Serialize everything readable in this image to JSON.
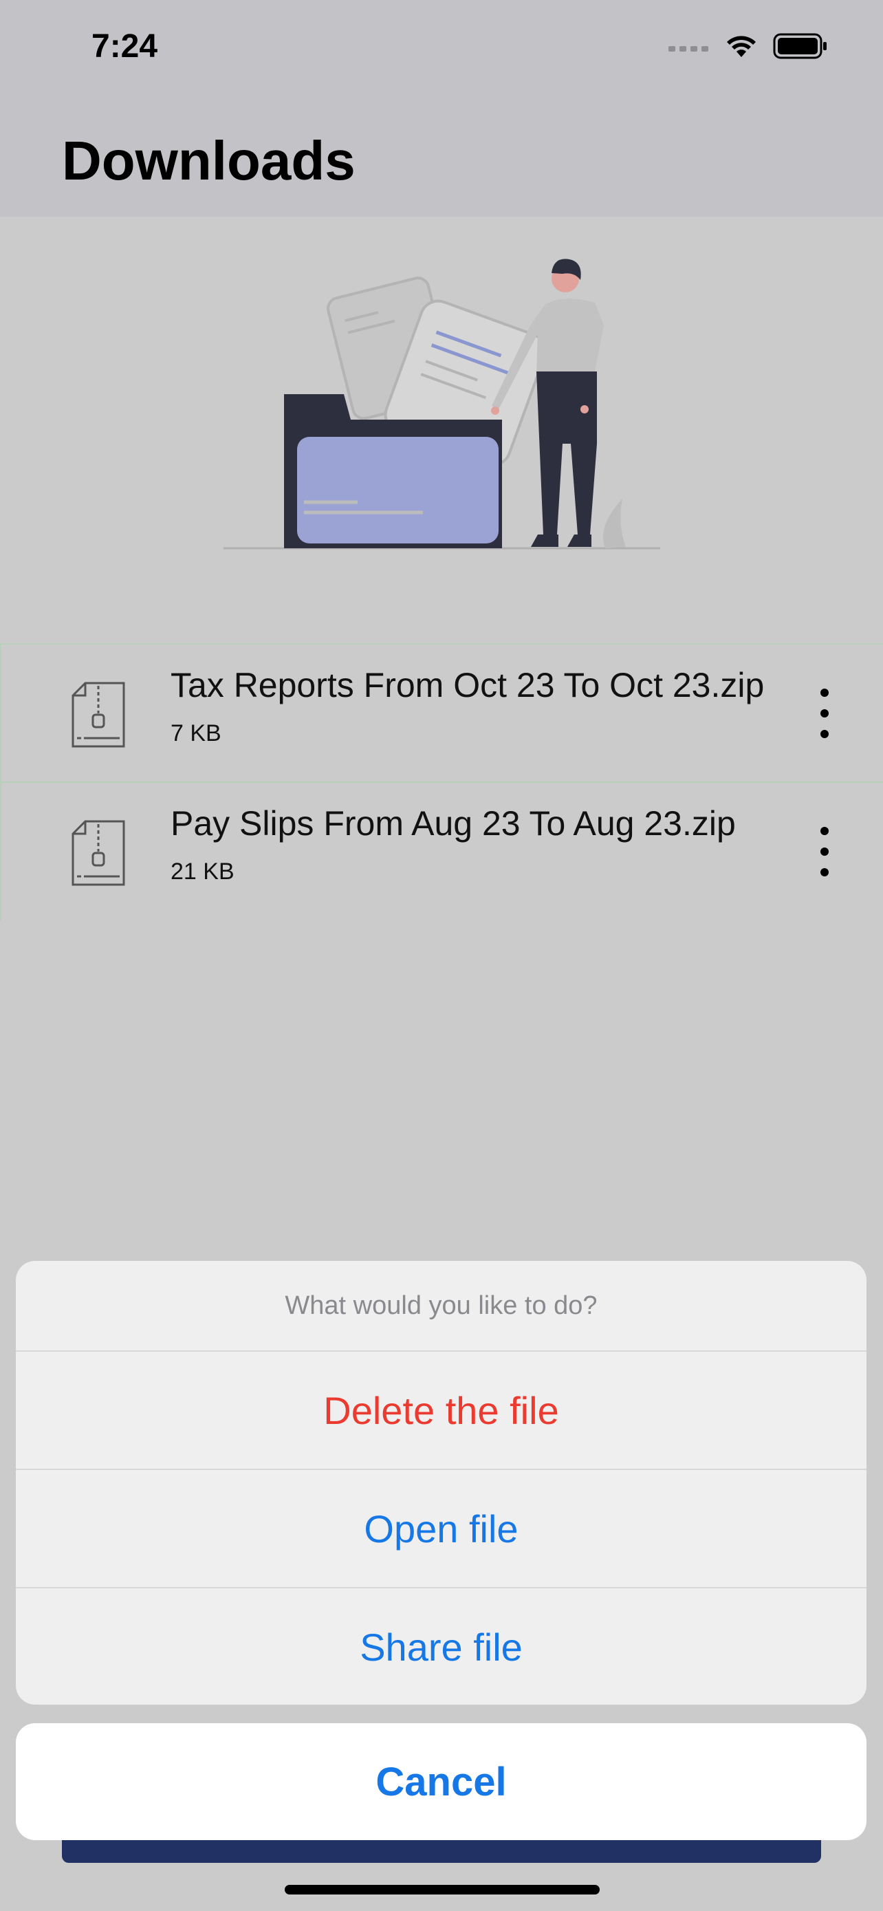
{
  "status_bar": {
    "time": "7:24"
  },
  "header": {
    "title": "Downloads"
  },
  "files": [
    {
      "name": "Tax Reports From Oct 23 To Oct 23.zip",
      "size": "7 KB"
    },
    {
      "name": "Pay Slips From Aug 23 To Aug 23.zip",
      "size": "21 KB"
    }
  ],
  "action_sheet": {
    "title": "What would you like to do?",
    "delete_label": "Delete the file",
    "open_label": "Open file",
    "share_label": "Share file",
    "cancel_label": "Cancel"
  },
  "colors": {
    "destructive": "#eb3b30",
    "accent": "#1677e6",
    "illustration_folder": "#9aa3d3",
    "bottom_button": "#223163"
  },
  "icons": {
    "status": [
      "signal-icon",
      "wifi-icon",
      "battery-icon"
    ],
    "file": "zip-file-icon",
    "menu": "more-vertical-icon"
  }
}
